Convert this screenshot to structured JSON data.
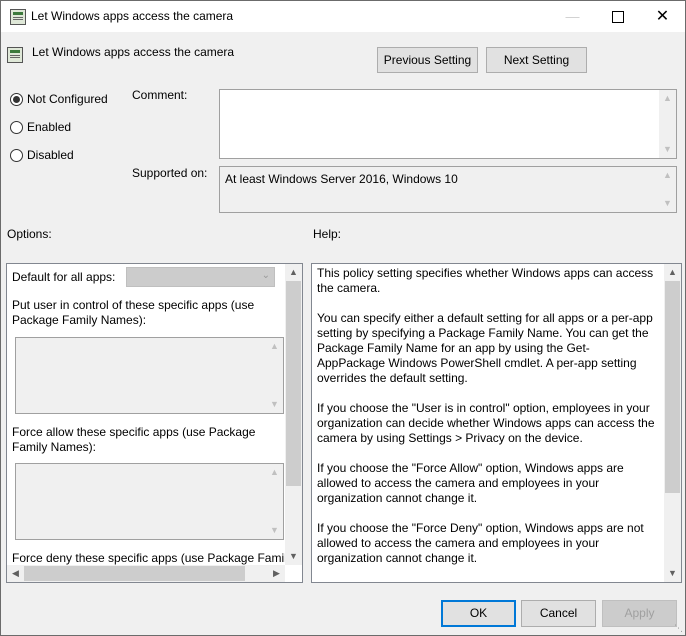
{
  "window": {
    "title": "Let Windows apps access the camera",
    "minimize_icon": "minimize-icon",
    "maximize_icon": "maximize-icon",
    "close_icon": "close-icon"
  },
  "header": {
    "policy_name": "Let Windows apps access the camera",
    "prev_label": "Previous Setting",
    "next_label": "Next Setting"
  },
  "state": {
    "options": [
      {
        "label": "Not Configured",
        "checked": true
      },
      {
        "label": "Enabled",
        "checked": false
      },
      {
        "label": "Disabled",
        "checked": false
      }
    ]
  },
  "comment": {
    "label": "Comment:",
    "value": ""
  },
  "supported": {
    "label": "Supported on:",
    "value": "At least Windows Server 2016, Windows 10"
  },
  "options_section": {
    "heading": "Options:",
    "default_label": "Default for all apps:",
    "default_value": "",
    "user_control_label": "Put user in control of these specific apps (use Package Family Names):",
    "force_allow_label": "Force allow these specific apps (use Package Family Names):",
    "force_deny_label": "Force deny these specific apps (use Package Family"
  },
  "help_section": {
    "heading": "Help:",
    "paragraphs": [
      "This policy setting specifies whether Windows apps can access the camera.",
      "You can specify either a default setting for all apps or a per-app setting by specifying a Package Family Name. You can get the Package Family Name for an app by using the Get-AppPackage Windows PowerShell cmdlet. A per-app setting overrides the default setting.",
      "If you choose the \"User is in control\" option, employees in your organization can decide whether Windows apps can access the camera by using Settings > Privacy on the device.",
      "If you choose the \"Force Allow\" option, Windows apps are allowed to access the camera and employees in your organization cannot change it.",
      "If you choose the \"Force Deny\" option, Windows apps are not allowed to access the camera and employees in your organization cannot change it."
    ]
  },
  "footer": {
    "ok_label": "OK",
    "cancel_label": "Cancel",
    "apply_label": "Apply"
  },
  "colors": {
    "accent": "#0078d7",
    "window_bg": "#f0f0f0"
  }
}
